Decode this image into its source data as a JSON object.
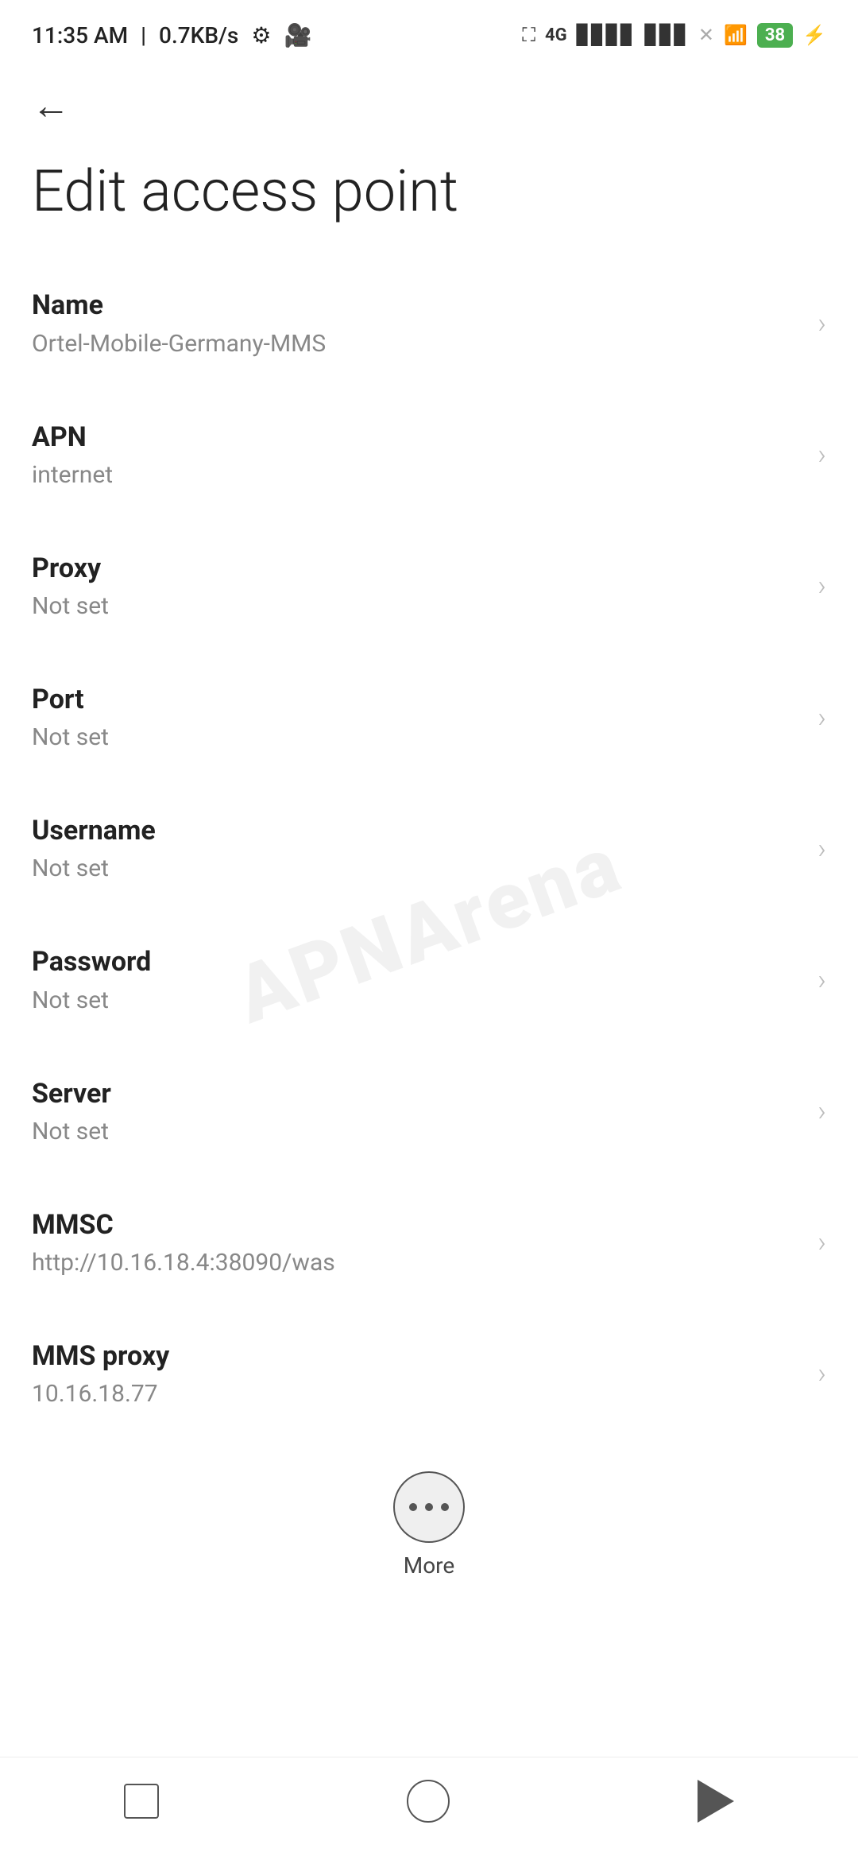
{
  "statusBar": {
    "time": "11:35 AM",
    "speed": "0.7KB/s",
    "batteryPercent": "38"
  },
  "header": {
    "backLabel": "←",
    "title": "Edit access point"
  },
  "fields": [
    {
      "label": "Name",
      "value": "Ortel-Mobile-Germany-MMS"
    },
    {
      "label": "APN",
      "value": "internet"
    },
    {
      "label": "Proxy",
      "value": "Not set"
    },
    {
      "label": "Port",
      "value": "Not set"
    },
    {
      "label": "Username",
      "value": "Not set"
    },
    {
      "label": "Password",
      "value": "Not set"
    },
    {
      "label": "Server",
      "value": "Not set"
    },
    {
      "label": "MMSC",
      "value": "http://10.16.18.4:38090/was"
    },
    {
      "label": "MMS proxy",
      "value": "10.16.18.77"
    }
  ],
  "more": {
    "label": "More"
  },
  "watermark": "APNArena",
  "nav": {
    "homeLabel": "home",
    "backLabel": "back",
    "recentLabel": "recent"
  }
}
